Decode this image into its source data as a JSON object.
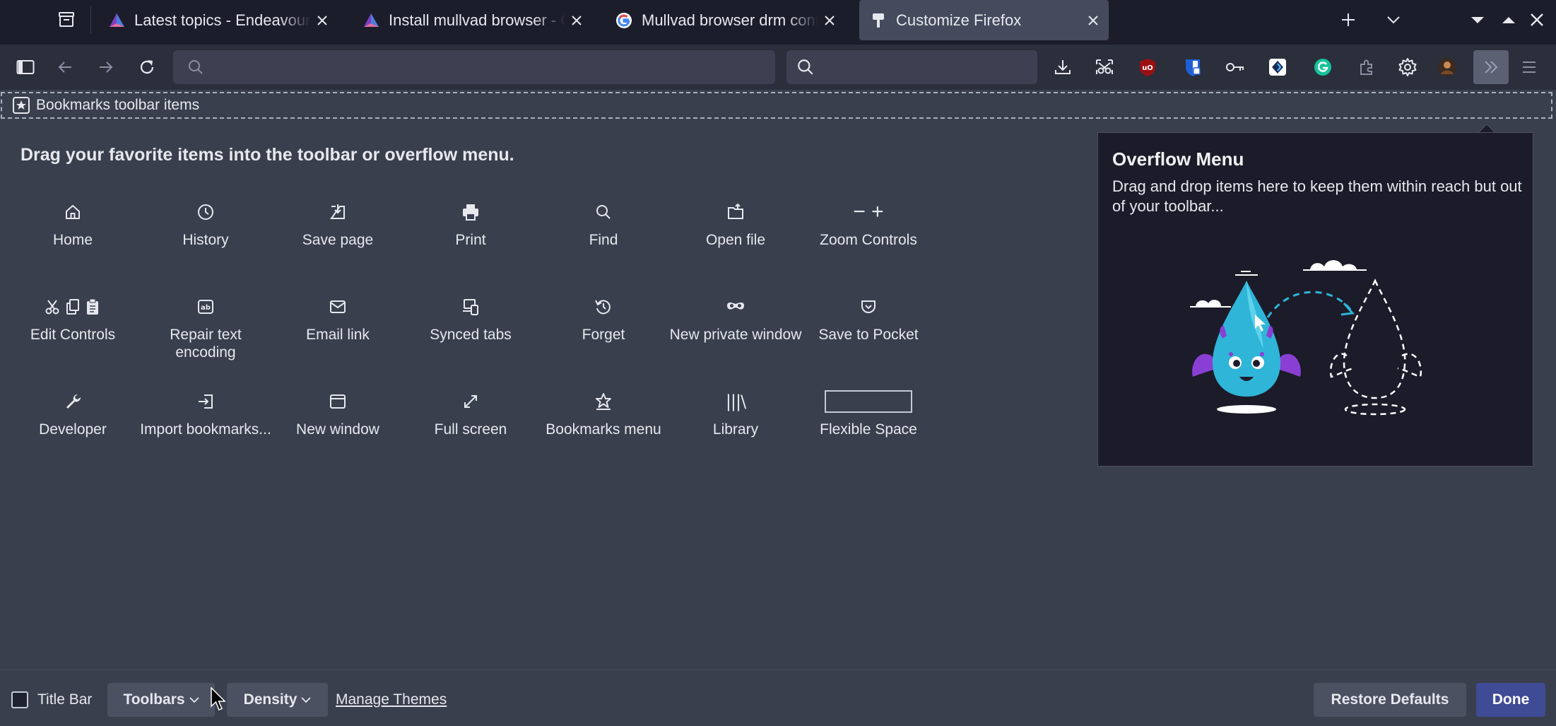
{
  "tabs": [
    {
      "title": "Latest topics - EndeavourOS",
      "favicon": "endeavouros-icon"
    },
    {
      "title": "Install mullvad browser - General",
      "favicon": "endeavouros-icon"
    },
    {
      "title": "Mullvad browser drm content",
      "favicon": "google-icon"
    },
    {
      "title": "Customize Firefox",
      "favicon": "customize-brush-icon",
      "selected": true
    }
  ],
  "bookmarks_toolbar": {
    "label": "Bookmarks toolbar items"
  },
  "palette": {
    "heading": "Drag your favorite items into the toolbar or overflow menu.",
    "items": [
      {
        "label": "Home",
        "icon": "home-icon"
      },
      {
        "label": "History",
        "icon": "clock-icon"
      },
      {
        "label": "Save page",
        "icon": "save-page-icon"
      },
      {
        "label": "Print",
        "icon": "printer-icon"
      },
      {
        "label": "Find",
        "icon": "search-icon"
      },
      {
        "label": "Open file",
        "icon": "open-file-icon"
      },
      {
        "label": "Zoom Controls",
        "icon": "zoom-icon",
        "glyph": "− +"
      },
      {
        "label": "Edit Controls",
        "icon": "cut-copy-paste-icon"
      },
      {
        "label": "Repair text encoding",
        "icon": "text-encoding-icon"
      },
      {
        "label": "Email link",
        "icon": "envelope-icon"
      },
      {
        "label": "Synced tabs",
        "icon": "synced-tabs-icon"
      },
      {
        "label": "Forget",
        "icon": "forget-icon"
      },
      {
        "label": "New private window",
        "icon": "private-mask-icon"
      },
      {
        "label": "Save to Pocket",
        "icon": "pocket-icon"
      },
      {
        "label": "Developer",
        "icon": "wrench-icon"
      },
      {
        "label": "Import bookmarks...",
        "icon": "import-icon"
      },
      {
        "label": "New window",
        "icon": "window-icon"
      },
      {
        "label": "Full screen",
        "icon": "fullscreen-icon"
      },
      {
        "label": "Bookmarks menu",
        "icon": "bookmark-star-icon"
      },
      {
        "label": "Library",
        "icon": "library-icon",
        "glyph": "|||\\"
      },
      {
        "label": "Flexible Space",
        "icon": "flexible-space-box"
      }
    ]
  },
  "overflow": {
    "title": "Overflow Menu",
    "description": "Drag and drop items here to keep them within reach but out of your toolbar..."
  },
  "footer": {
    "title_bar_label": "Title Bar",
    "toolbars_label": "Toolbars",
    "density_label": "Density",
    "manage_themes_label": "Manage Themes",
    "restore_label": "Restore Defaults",
    "done_label": "Done"
  },
  "colors": {
    "page_bg": "#3a3f4d",
    "tabstrip_bg": "#1c1d2b",
    "navbar_bg": "#2b2e3b",
    "accent": "#3f4b95",
    "panel_bg": "#1c1b29",
    "illustration_blue": "#2fb5d8",
    "illustration_purple": "#8a3fd4",
    "ublock_red": "#9b0f13"
  }
}
